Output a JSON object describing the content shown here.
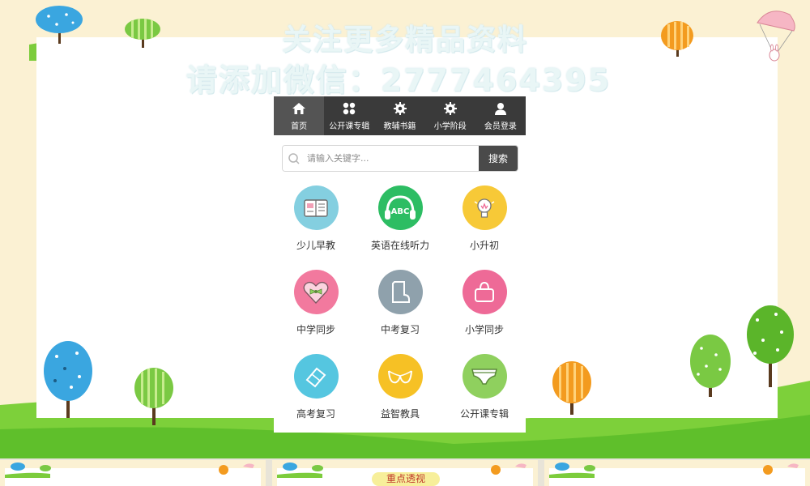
{
  "watermark": {
    "line1": "关注更多精品资料",
    "line2": "请添加微信：2777464395"
  },
  "nav": {
    "items": [
      {
        "label": "首页",
        "icon": "home-icon",
        "active": true
      },
      {
        "label": "公开课专辑",
        "icon": "grid-icon",
        "active": false
      },
      {
        "label": "教辅书籍",
        "icon": "gear-icon",
        "active": false
      },
      {
        "label": "小学阶段",
        "icon": "gear-icon",
        "active": false
      },
      {
        "label": "会员登录",
        "icon": "user-icon",
        "active": false
      }
    ]
  },
  "search": {
    "placeholder": "请输入关键字...",
    "button_label": "搜索"
  },
  "categories": [
    {
      "label": "少儿早教",
      "icon": "picture-book-icon",
      "color": "#84cfe0"
    },
    {
      "label": "英语在线听力",
      "icon": "headphones-abc-icon",
      "color": "#2dbd63"
    },
    {
      "label": "小升初",
      "icon": "lightbulb-icon",
      "color": "#f7c937"
    },
    {
      "label": "中学同步",
      "icon": "heart-bow-icon",
      "color": "#f2799e"
    },
    {
      "label": "中考复习",
      "icon": "boot-icon",
      "color": "#8fa1ac"
    },
    {
      "label": "小学同步",
      "icon": "bag-icon",
      "color": "#ee6a97"
    },
    {
      "label": "高考复习",
      "icon": "eraser-icon",
      "color": "#55c6e0"
    },
    {
      "label": "益智教具",
      "icon": "bra-icon",
      "color": "#f6c125"
    },
    {
      "label": "公开课专辑",
      "icon": "underwear-icon",
      "color": "#8fd05e"
    }
  ],
  "bottom_badge": "重点透视",
  "colors": {
    "background": "#fbf1d3",
    "grass": "#6cc83a",
    "nav_bg": "#3a3a3a",
    "nav_active": "#545454"
  }
}
